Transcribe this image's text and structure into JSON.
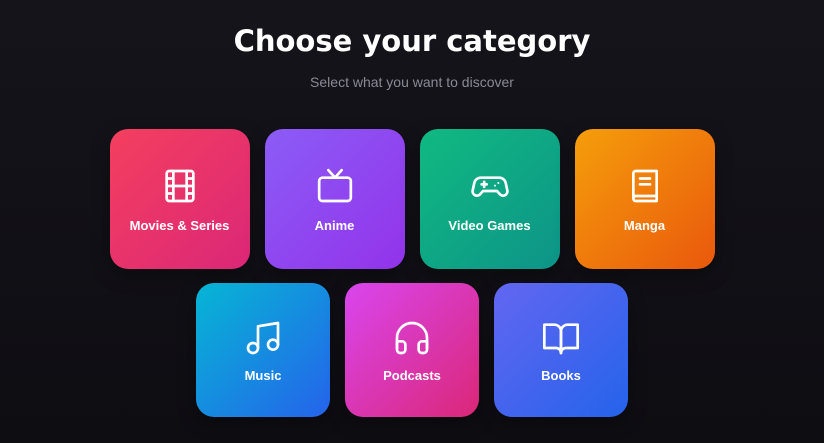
{
  "header": {
    "title": "Choose your category",
    "subtitle": "Select what you want to discover"
  },
  "categories": [
    {
      "label": "Movies & Series",
      "icon": "film-icon",
      "colors": [
        "#f43f5e",
        "#db2777"
      ]
    },
    {
      "label": "Anime",
      "icon": "tv-icon",
      "colors": [
        "#8b5cf6",
        "#9333ea"
      ]
    },
    {
      "label": "Video Games",
      "icon": "gamepad-icon",
      "colors": [
        "#10b981",
        "#0d9488"
      ]
    },
    {
      "label": "Manga",
      "icon": "book-icon",
      "colors": [
        "#f59e0b",
        "#ea580c"
      ]
    },
    {
      "label": "Music",
      "icon": "music-note-icon",
      "colors": [
        "#06b6d4",
        "#2563eb"
      ]
    },
    {
      "label": "Podcasts",
      "icon": "headphones-icon",
      "colors": [
        "#d946ef",
        "#db2777"
      ]
    },
    {
      "label": "Books",
      "icon": "open-book-icon",
      "colors": [
        "#6366f1",
        "#2563eb"
      ]
    }
  ]
}
